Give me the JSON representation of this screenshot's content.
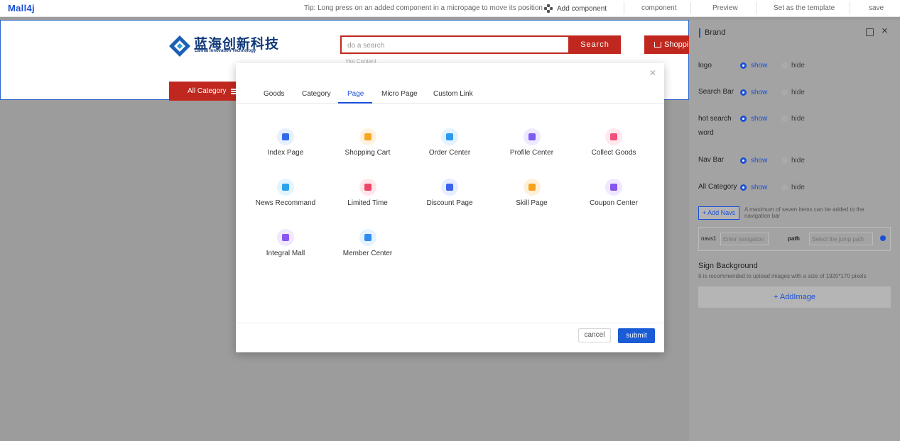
{
  "topbar": {
    "logo": "Mall4j",
    "tip": "Tip: Long press on an added component in a micropage to move its position",
    "add_component": "Add component",
    "items": [
      "component",
      "Preview",
      "Set as the template",
      "save"
    ]
  },
  "store": {
    "brand_cn": "蓝海创新科技",
    "brand_en": "Lanhai Innovation Technology",
    "search_placeholder": "do a search",
    "search_button": "Search",
    "cart_button": "Shopping Cart",
    "hot_content": "Hot Content",
    "all_category": "All Category"
  },
  "panel": {
    "title": "Brand",
    "options": [
      {
        "label": "logo",
        "show": "show",
        "hide": "hide"
      },
      {
        "label": "Search Bar",
        "show": "show",
        "hide": "hide"
      },
      {
        "label": "hot search word",
        "show": "show",
        "hide": "hide"
      },
      {
        "label": "Nav Bar",
        "show": "show",
        "hide": "hide"
      },
      {
        "label": "All Category",
        "show": "show",
        "hide": "hide"
      }
    ],
    "add_navs": "+ Add Navs",
    "navs_note": "A maximum of seven items can be added to the navigation bar",
    "navs_label": "navs1",
    "navs_placeholder": "Enter navigation",
    "path_label": "path",
    "path_placeholder": "Select the jump path",
    "sign_title": "Sign Background",
    "sign_desc": "It is recommended to upload images with a size of 1920*170 pixels",
    "add_image": "+ AddImage"
  },
  "modal": {
    "tabs": [
      "Goods",
      "Category",
      "Page",
      "Micro Page",
      "Custom Link"
    ],
    "active_tab": "Page",
    "pages": [
      {
        "label": "Index Page",
        "icon": "home-icon",
        "bg": "#e7f0ff",
        "fg": "#2f6bea"
      },
      {
        "label": "Shopping Cart",
        "icon": "cart-icon",
        "bg": "#fff3df",
        "fg": "#f5a623"
      },
      {
        "label": "Order Center",
        "icon": "clipboard-icon",
        "bg": "#e4f3ff",
        "fg": "#2b9af3"
      },
      {
        "label": "Profile Center",
        "icon": "user-icon",
        "bg": "#efe9ff",
        "fg": "#7c5cf5"
      },
      {
        "label": "Collect Goods",
        "icon": "star-icon",
        "bg": "#ffe9ee",
        "fg": "#f2507a"
      },
      {
        "label": "News Recommand",
        "icon": "news-icon",
        "bg": "#e3f4ff",
        "fg": "#2aa3e8"
      },
      {
        "label": "Limited Time",
        "icon": "discount-icon",
        "bg": "#ffe6ea",
        "fg": "#ee4766"
      },
      {
        "label": "Discount Page",
        "icon": "bag-icon",
        "bg": "#e8edff",
        "fg": "#3a62ec"
      },
      {
        "label": "Skill Page",
        "icon": "lightning-icon",
        "bg": "#fff0dc",
        "fg": "#f6a21c"
      },
      {
        "label": "Coupon Center",
        "icon": "coupon-icon",
        "bg": "#efe8ff",
        "fg": "#8456ee"
      },
      {
        "label": "Integral Mall",
        "icon": "star-badge-icon",
        "bg": "#efe8ff",
        "fg": "#8a55f0"
      },
      {
        "label": "Member Center",
        "icon": "crown-icon",
        "bg": "#e5f2ff",
        "fg": "#2f8cf0"
      }
    ],
    "cancel": "cancel",
    "submit": "submit"
  },
  "colors": {
    "accent": "#1a4fd8",
    "brand_red": "#c0281f"
  }
}
